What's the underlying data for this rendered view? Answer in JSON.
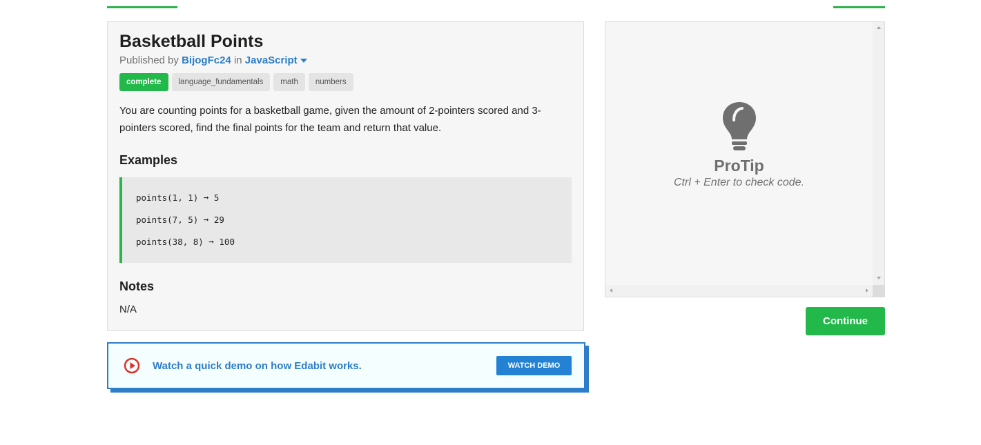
{
  "colors": {
    "accent_green": "#22b84a",
    "link_blue": "#2d7dc9",
    "button_blue": "#2382d4",
    "play_red": "#d9342b"
  },
  "challenge": {
    "title": "Basketball Points",
    "published_prefix": "Published by",
    "author": "BijogFc24",
    "in_word": "in",
    "language": "JavaScript",
    "tags": [
      "complete",
      "language_fundamentals",
      "math",
      "numbers"
    ],
    "description": "You are counting points for a basketball game, given the amount of 2-pointers scored and 3-pointers scored, find the final points for the team and return that value.",
    "examples_heading": "Examples",
    "examples": [
      "points(1, 1) ➞ 5",
      "points(7, 5) ➞ 29",
      "points(38, 8) ➞ 100"
    ],
    "notes_heading": "Notes",
    "notes": "N/A"
  },
  "demo": {
    "text": "Watch a quick demo on how Edabit works.",
    "button": "WATCH DEMO",
    "icon": "play-icon"
  },
  "editor": {
    "protip_title": "ProTip",
    "protip_text": "Ctrl + Enter to check code.",
    "icon": "lightbulb-icon"
  },
  "actions": {
    "continue": "Continue"
  }
}
